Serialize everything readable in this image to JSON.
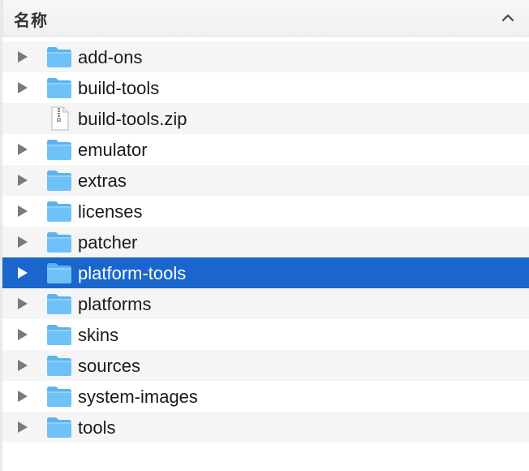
{
  "header": {
    "name_column_label": "名称",
    "sort_icon": "chevron-up-icon"
  },
  "items": [
    {
      "label": "add-ons",
      "kind": "folder",
      "expandable": true,
      "selected": false
    },
    {
      "label": "build-tools",
      "kind": "folder",
      "expandable": true,
      "selected": false
    },
    {
      "label": "build-tools.zip",
      "kind": "zip",
      "expandable": false,
      "selected": false
    },
    {
      "label": "emulator",
      "kind": "folder",
      "expandable": true,
      "selected": false
    },
    {
      "label": "extras",
      "kind": "folder",
      "expandable": true,
      "selected": false
    },
    {
      "label": "licenses",
      "kind": "folder",
      "expandable": true,
      "selected": false
    },
    {
      "label": "patcher",
      "kind": "folder",
      "expandable": true,
      "selected": false
    },
    {
      "label": "platform-tools",
      "kind": "folder",
      "expandable": true,
      "selected": true
    },
    {
      "label": "platforms",
      "kind": "folder",
      "expandable": true,
      "selected": false
    },
    {
      "label": "skins",
      "kind": "folder",
      "expandable": true,
      "selected": false
    },
    {
      "label": "sources",
      "kind": "folder",
      "expandable": true,
      "selected": false
    },
    {
      "label": "system-images",
      "kind": "folder",
      "expandable": true,
      "selected": false
    },
    {
      "label": "tools",
      "kind": "folder",
      "expandable": true,
      "selected": false
    }
  ],
  "colors": {
    "selection": "#1a66cc",
    "stripe": "#f5f5f5",
    "folder_body": "#6fc2f7",
    "folder_tab": "#5ab3ee"
  }
}
